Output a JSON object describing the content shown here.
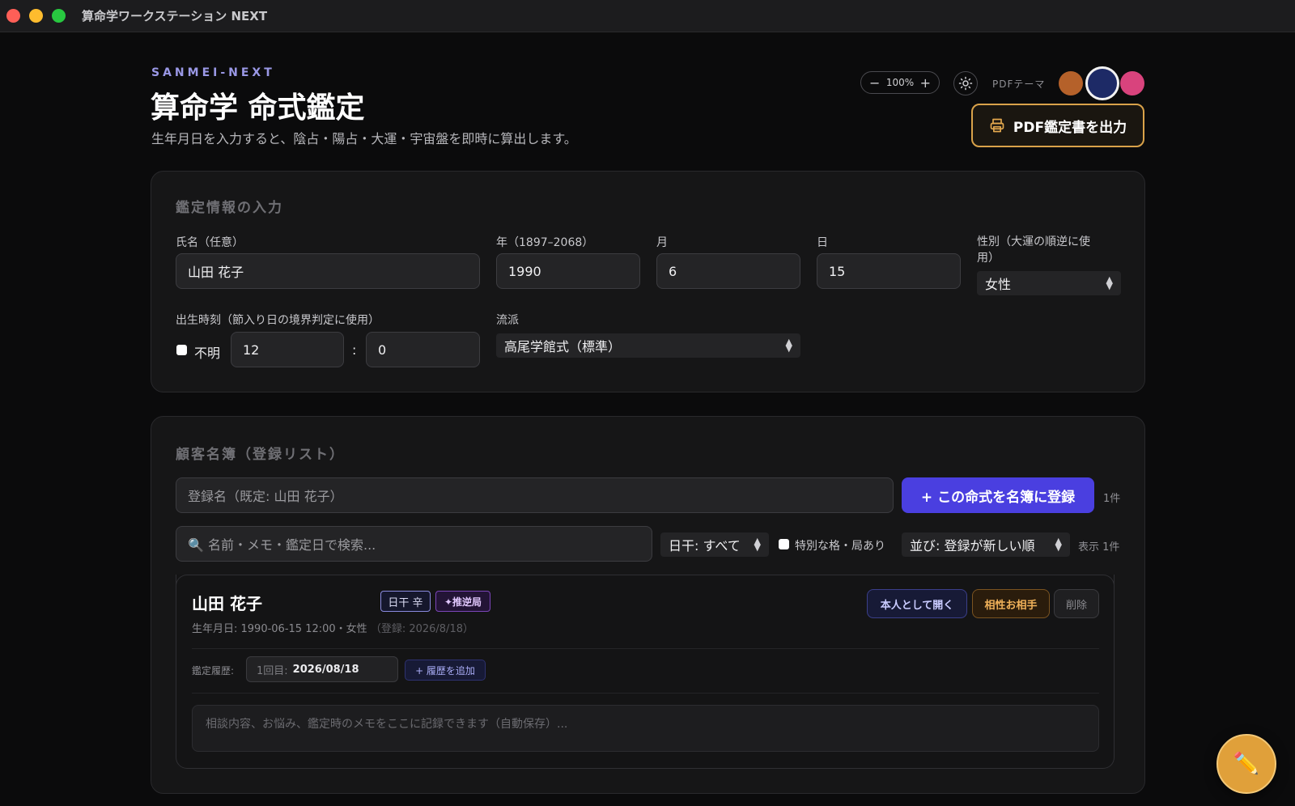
{
  "window": {
    "title": "算命学ワークステーション NEXT"
  },
  "header": {
    "brand": "SANMEI-NEXT",
    "title": "算命学 命式鑑定",
    "subtitle": "生年月日を入力すると、陰占・陽占・大運・宇宙盤を即時に算出します。",
    "zoom_minus": "−",
    "zoom_value": "100%",
    "zoom_plus": "+",
    "pdf_theme_label": "PDFテーマ",
    "pdf_theme_colors": [
      "#b5612a",
      "#1d2a66",
      "#d9437d"
    ],
    "pdf_button_label": "PDF鑑定書を出力"
  },
  "input_form": {
    "section_title": "鑑定情報の入力",
    "name_label": "氏名（任意）",
    "name_value": "山田 花子",
    "year_label": "年（1897–2068）",
    "year_value": "1990",
    "month_label": "月",
    "month_value": "6",
    "day_label": "日",
    "day_value": "15",
    "gender_label": "性別（大運の順逆に使用）",
    "gender_value": "女性",
    "birth_time_label": "出生時刻（節入り日の境界判定に使用）",
    "unknown_label": "不明",
    "hour_value": "12",
    "time_separator": ":",
    "minute_value": "0",
    "school_label": "流派",
    "school_value": "高尾学館式（標準）"
  },
  "client_list": {
    "section_title": "顧客名簿（登録リスト）",
    "register_placeholder": "登録名（既定: 山田 花子）",
    "register_button": "+ この命式を名簿に登録",
    "total_count": "1件",
    "search_placeholder": "🔍 名前・メモ・鑑定日で検索...",
    "filter_value": "日干: すべて",
    "special_label": "特別な格・局あり",
    "sort_value": "並び: 登録が新しい順",
    "shown_count": "表示 1件",
    "items": [
      {
        "name": "山田 花子",
        "badge_kan": "日干 辛",
        "badge_kyoku": "✦推逆局",
        "meta": "生年月日: 1990-06-15 12:00・女性",
        "registered": "（登録: 2026/8/18）",
        "open_label": "本人として開く",
        "compat_label": "相性お相手",
        "delete_label": "削除",
        "history_label": "鑑定履歴:",
        "history_no": "1回目:",
        "history_date": "2026/08/18",
        "history_add": "+ 履歴を追加",
        "memo_placeholder": "相談内容、お悩み、鑑定時のメモをここに記録できます（自動保存）..."
      }
    ]
  },
  "fab": {
    "icon": "✏️"
  }
}
